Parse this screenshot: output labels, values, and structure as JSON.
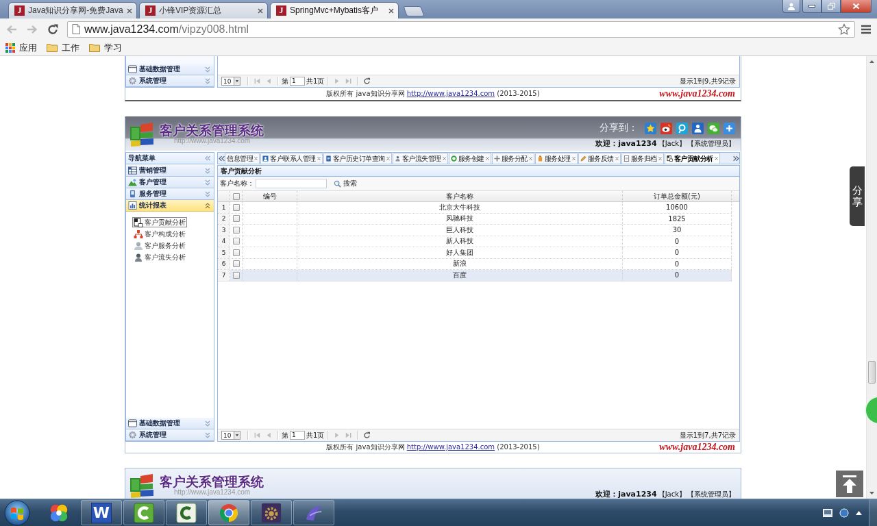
{
  "browser": {
    "tabs": [
      {
        "favicon": "J",
        "title": "Java知识分享网-免费Java",
        "selected": false
      },
      {
        "favicon": "J",
        "title": "小锋VIP资源汇总",
        "selected": false
      },
      {
        "favicon": "J",
        "title": "SpringMvc+Mybatis客户",
        "selected": true
      }
    ],
    "back": {
      "disabled": true
    },
    "forward": {
      "disabled": true
    },
    "address": {
      "host": "www.java1234.com",
      "path": "/vipzy008.html"
    },
    "bookmarks": [
      {
        "kind": "apps",
        "label": "应用"
      },
      {
        "kind": "folder",
        "label": "工作"
      },
      {
        "kind": "folder",
        "label": "学习"
      }
    ]
  },
  "previous_frame": {
    "sidebar": [
      {
        "label": "基础数据管理",
        "expanded": false
      },
      {
        "label": "系统管理",
        "expanded": false
      }
    ],
    "pager": {
      "page_size": "10",
      "nav_disabled": true,
      "page_prefix": "第",
      "page": "1",
      "page_suffix": "共1页",
      "info": "显示1到9,共9记录"
    },
    "footer": {
      "copyright": "版权所有 java知识分享网",
      "link": "http://www.java1234.com",
      "years": "(2013-2015)",
      "logo_text": "www.java1234.com"
    }
  },
  "frame": {
    "header": {
      "title": "客户关系管理系统",
      "url": "http://www.java1234.com",
      "share_label": "分享到：",
      "welcome": "欢迎：java1234",
      "user": "【Jack】",
      "role": "【系统管理员】"
    },
    "sidebar": {
      "title": "导航菜单",
      "menus": [
        {
          "label": "营销管理",
          "expanded": false
        },
        {
          "label": "客户管理",
          "expanded": false
        },
        {
          "label": "服务管理",
          "expanded": false
        },
        {
          "label": "统计报表",
          "expanded": true,
          "items": [
            {
              "label": "客户贡献分析",
              "selected": true
            },
            {
              "label": "客户构成分析",
              "selected": false
            },
            {
              "label": "客户服务分析",
              "selected": false
            },
            {
              "label": "客户流失分析",
              "selected": false
            }
          ]
        },
        {
          "label": "基础数据管理",
          "expanded": false
        },
        {
          "label": "系统管理",
          "expanded": false
        }
      ]
    },
    "tabs": [
      {
        "label": "信息管理",
        "selected": false
      },
      {
        "label": "客户联系人管理",
        "selected": false
      },
      {
        "label": "客户历史订单查询",
        "selected": false
      },
      {
        "label": "客户流失管理",
        "selected": false
      },
      {
        "label": "服务创建",
        "selected": false
      },
      {
        "label": "服务分配",
        "selected": false
      },
      {
        "label": "服务处理",
        "selected": false
      },
      {
        "label": "服务反馈",
        "selected": false
      },
      {
        "label": "服务归档",
        "selected": false
      },
      {
        "label": "客户贡献分析",
        "selected": true
      }
    ],
    "panel": {
      "title": "客户贡献分析",
      "search": {
        "label": "客户名称：",
        "button": "搜索"
      }
    },
    "table": {
      "columns": [
        "编号",
        "客户名称",
        "订单总金额(元)"
      ],
      "header_checked": false,
      "rows": [
        {
          "number": "1",
          "checked": false,
          "hovered": false,
          "name": "北京大牛科技",
          "amount": "10600"
        },
        {
          "number": "2",
          "checked": false,
          "hovered": false,
          "name": "风驰科技",
          "amount": "1825"
        },
        {
          "number": "3",
          "checked": false,
          "hovered": false,
          "name": "巨人科技",
          "amount": "30"
        },
        {
          "number": "4",
          "checked": false,
          "hovered": false,
          "name": "新人科技",
          "amount": "0"
        },
        {
          "number": "5",
          "checked": false,
          "hovered": false,
          "name": "好人集团",
          "amount": "0"
        },
        {
          "number": "6",
          "checked": false,
          "hovered": false,
          "name": "新浪",
          "amount": "0"
        },
        {
          "number": "7",
          "checked": false,
          "hovered": true,
          "name": "百度",
          "amount": "0"
        }
      ]
    },
    "pager": {
      "page_size": "10",
      "nav_disabled": true,
      "page_prefix": "第",
      "page": "1",
      "page_suffix": "共1页",
      "info": "显示1到7,共7记录"
    },
    "footer": {
      "copyright": "版权所有 java知识分享网",
      "link": "http://www.java1234.com",
      "years": "(2013-2015)",
      "logo_text": "www.java1234.com"
    }
  },
  "next_frame": {
    "title": "客户关系管理系统",
    "url": "http://www.java1234.com",
    "welcome": "欢迎：java1234",
    "user": "【Jack】",
    "role": "【系统管理员】"
  },
  "share_tab": "分享",
  "taskbar": {
    "apps": [
      {
        "kind": "pinwheel",
        "running": false,
        "active": false
      },
      {
        "kind": "letter",
        "glyph": "W",
        "running": true,
        "active": false
      },
      {
        "kind": "arc",
        "running": true,
        "active": false
      },
      {
        "kind": "arclight",
        "running": true,
        "active": false
      },
      {
        "kind": "browser",
        "running": true,
        "active": true
      },
      {
        "kind": "gear",
        "running": true,
        "active": false
      },
      {
        "kind": "curve",
        "running": true,
        "active": false
      }
    ]
  }
}
